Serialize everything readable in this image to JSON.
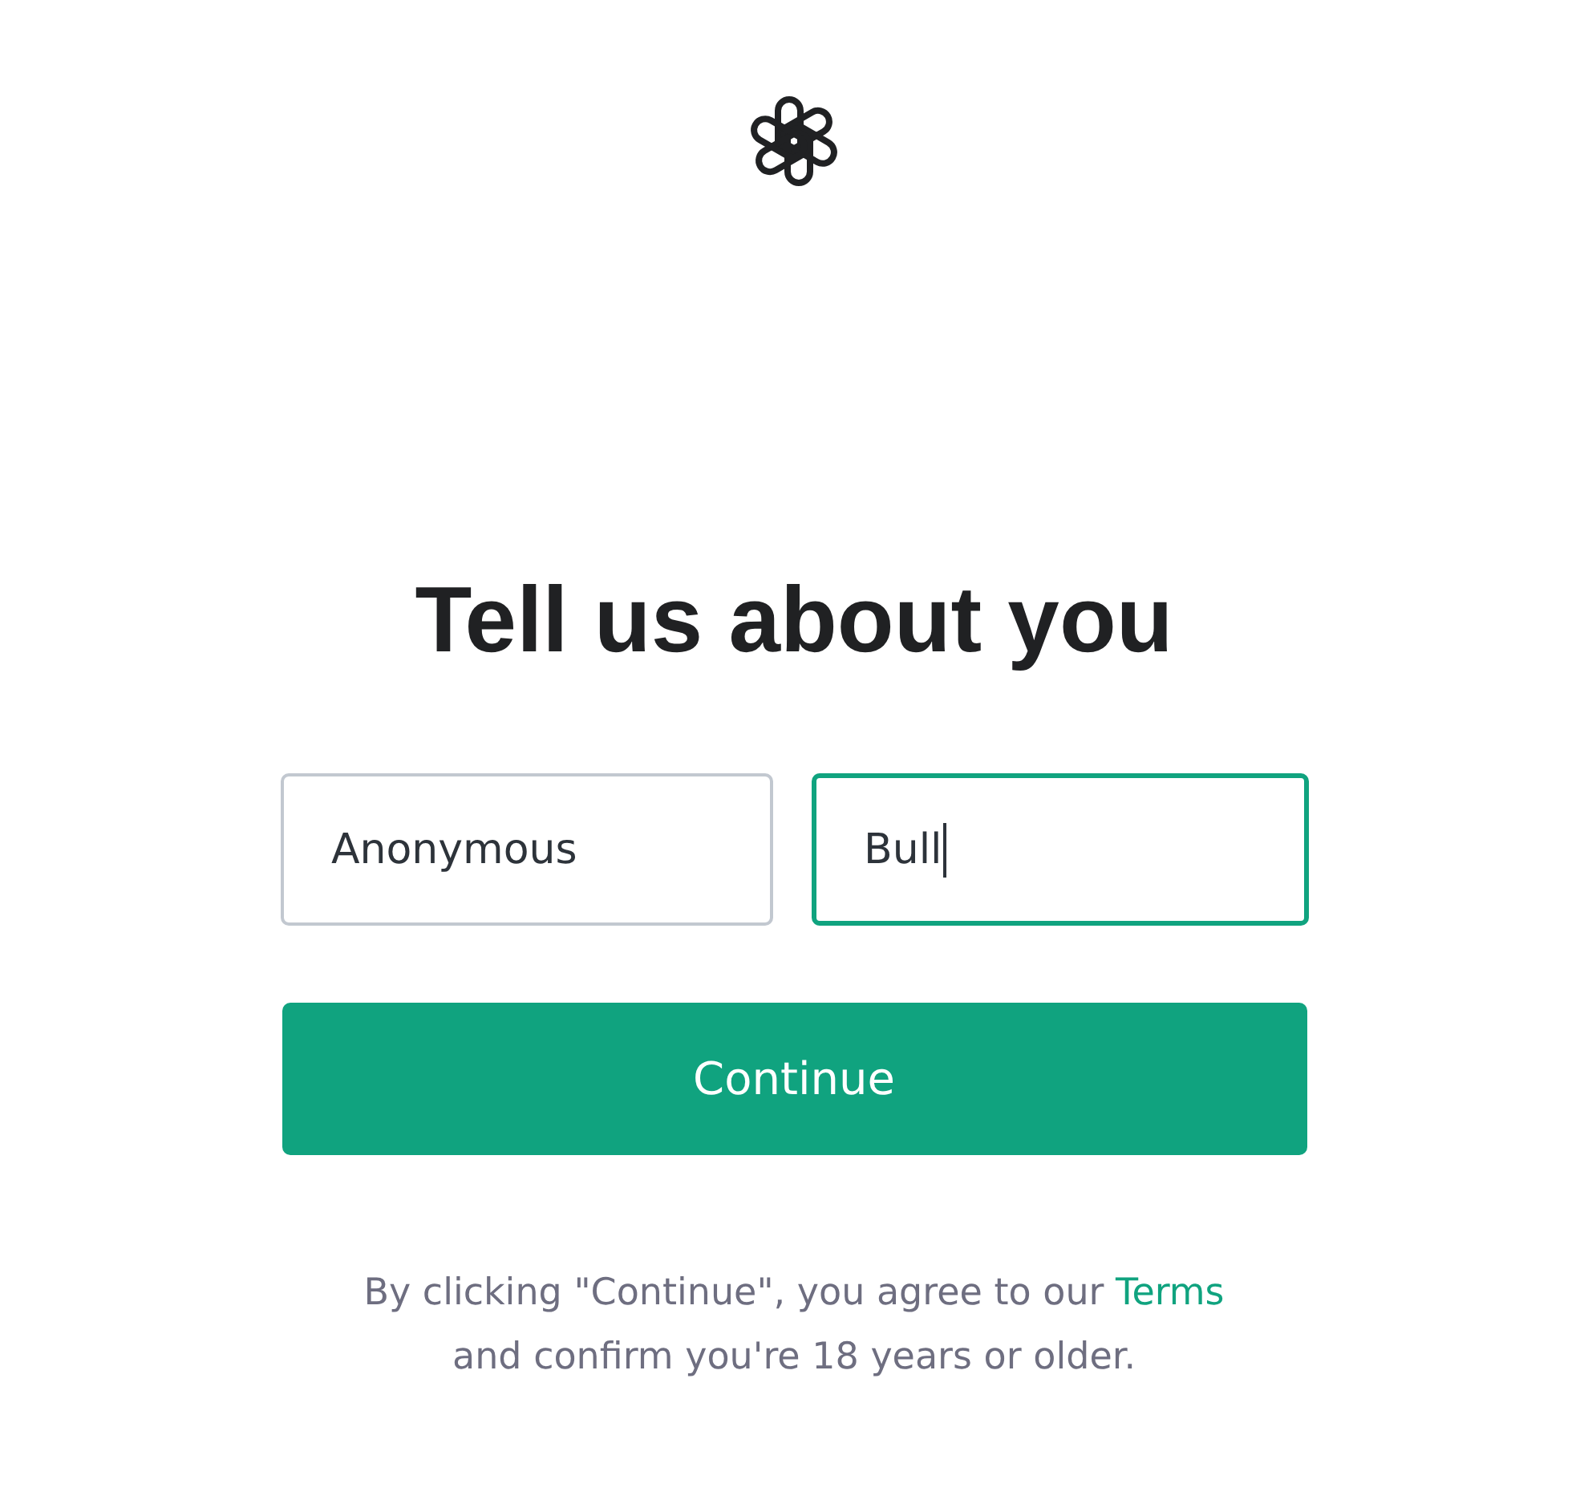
{
  "heading": "Tell us about you",
  "fields": [
    {
      "value": "Anonymous",
      "focused": false
    },
    {
      "value": "Bull",
      "focused": true
    }
  ],
  "continue_button": "Continue",
  "notice": {
    "text": "By clicking \"Continue\", you agree to our",
    "link": "Terms",
    "text_after": "and confirm you're 18 years or older."
  }
}
